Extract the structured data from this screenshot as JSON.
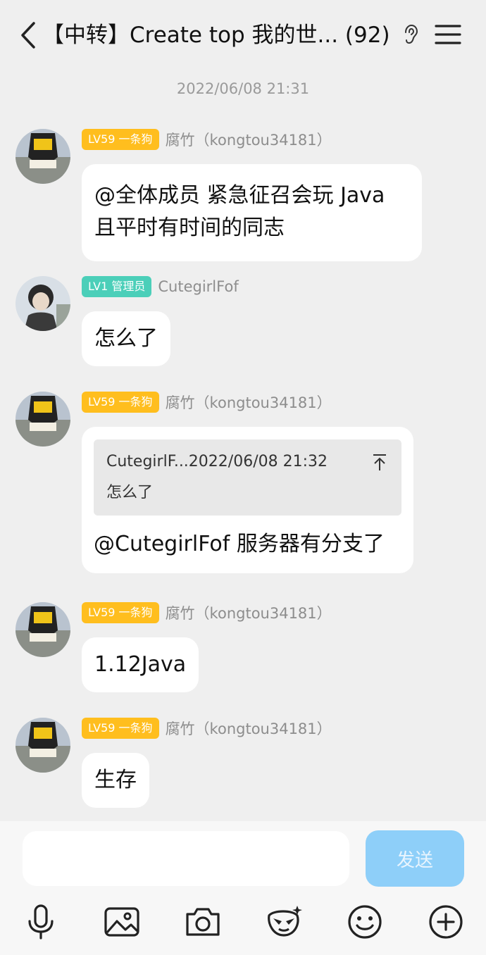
{
  "header": {
    "title": "【中转】Create top 我的世... (92)"
  },
  "timestamp": "2022/06/08 21:31",
  "messages": [
    {
      "badge": "LV59 一条狗",
      "badge_color": "#ffbe1e",
      "name": "腐竹（kongtou34181）",
      "lines": [
        "@全体成员 紧急征召会玩 Java",
        "且平时有时间的同志"
      ]
    },
    {
      "badge": "LV1 管理员",
      "badge_color": "#4bcfb9",
      "name": "CutegirlFof",
      "text": "怎么了"
    },
    {
      "badge": "LV59 一条狗",
      "badge_color": "#ffbe1e",
      "name": "腐竹（kongtou34181）",
      "quote_header": "CutegirlF...2022/06/08 21:32",
      "quote_text": "怎么了",
      "text": "@CutegirlFof 服务器有分支了"
    },
    {
      "badge": "LV59 一条狗",
      "badge_color": "#ffbe1e",
      "name": "腐竹（kongtou34181）",
      "text": "1.12Java"
    },
    {
      "badge": "LV59 一条狗",
      "badge_color": "#ffbe1e",
      "name": "腐竹（kongtou34181）",
      "text": "生存"
    }
  ],
  "composer": {
    "input_value": "",
    "send_label": "发送",
    "send_color": "#8ecff9"
  },
  "toolbar": {
    "icons": [
      "microphone-icon",
      "image-icon",
      "camera-icon",
      "sticker-icon",
      "emoji-icon",
      "plus-icon"
    ]
  }
}
